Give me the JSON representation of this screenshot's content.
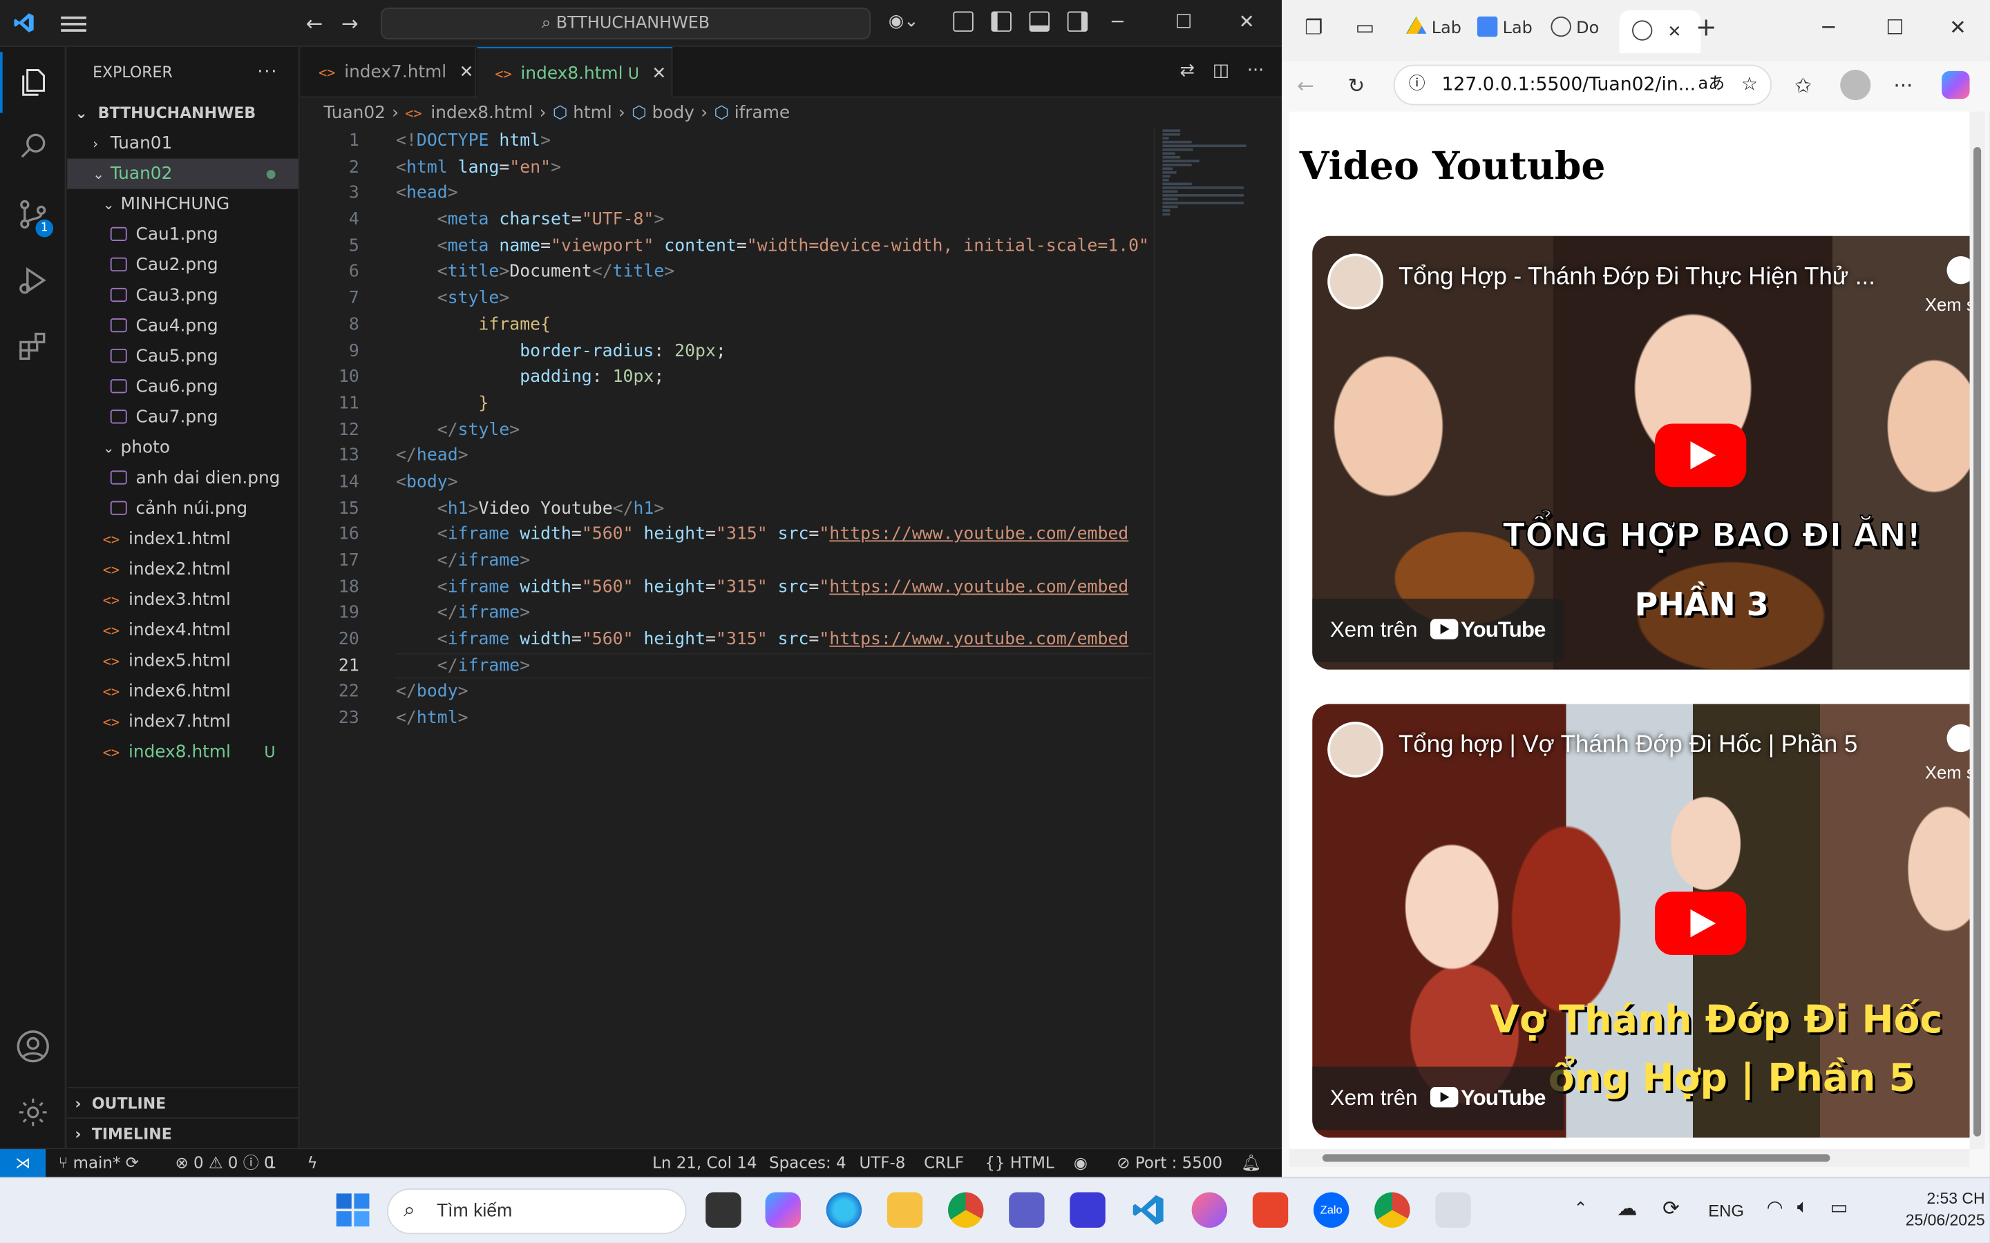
{
  "vscode": {
    "search_label": "BTTHUCHANHWEB",
    "explorer_title": "EXPLORER",
    "workspace_root": "BTTHUCHANHWEB",
    "tree": [
      {
        "label": "Tuan01",
        "type": "folder",
        "depth": 1,
        "open": false
      },
      {
        "label": "Tuan02",
        "type": "folder",
        "depth": 1,
        "open": true,
        "selected": true
      },
      {
        "label": "MINHCHUNG",
        "type": "folder",
        "depth": 2,
        "open": true
      },
      {
        "label": "Cau1.png",
        "type": "image",
        "depth": 3
      },
      {
        "label": "Cau2.png",
        "type": "image",
        "depth": 3
      },
      {
        "label": "Cau3.png",
        "type": "image",
        "depth": 3
      },
      {
        "label": "Cau4.png",
        "type": "image",
        "depth": 3
      },
      {
        "label": "Cau5.png",
        "type": "image",
        "depth": 3
      },
      {
        "label": "Cau6.png",
        "type": "image",
        "depth": 3
      },
      {
        "label": "Cau7.png",
        "type": "image",
        "depth": 3
      },
      {
        "label": "photo",
        "type": "folder",
        "depth": 2,
        "open": true
      },
      {
        "label": "anh dai dien.png",
        "type": "image",
        "depth": 3
      },
      {
        "label": "cảnh núi.png",
        "type": "image",
        "depth": 3
      },
      {
        "label": "index1.html",
        "type": "html",
        "depth": 2
      },
      {
        "label": "index2.html",
        "type": "html",
        "depth": 2
      },
      {
        "label": "index3.html",
        "type": "html",
        "depth": 2
      },
      {
        "label": "index4.html",
        "type": "html",
        "depth": 2
      },
      {
        "label": "index5.html",
        "type": "html",
        "depth": 2
      },
      {
        "label": "index6.html",
        "type": "html",
        "depth": 2
      },
      {
        "label": "index7.html",
        "type": "html",
        "depth": 2
      },
      {
        "label": "index8.html",
        "type": "html",
        "depth": 2,
        "git": "U",
        "modified": true
      }
    ],
    "outline_label": "OUTLINE",
    "timeline_label": "TIMELINE",
    "tabs": [
      {
        "label": "index7.html",
        "active": false
      },
      {
        "label": "index8.html",
        "active": true,
        "git": "U"
      }
    ],
    "breadcrumb": [
      "Tuan02",
      "index8.html",
      "html",
      "body",
      "iframe"
    ],
    "current_line": 21,
    "code": [
      [
        [
          "br",
          "<!"
        ],
        [
          "tag",
          "DOCTYPE"
        ],
        [
          "txt",
          " "
        ],
        [
          "attr",
          "html"
        ],
        [
          "br",
          ">"
        ]
      ],
      [
        [
          "br",
          "<"
        ],
        [
          "tag",
          "html"
        ],
        [
          "txt",
          " "
        ],
        [
          "attr",
          "lang"
        ],
        [
          "txt",
          "="
        ],
        [
          "str",
          "\"en\""
        ],
        [
          "br",
          ">"
        ]
      ],
      [
        [
          "br",
          "<"
        ],
        [
          "tag",
          "head"
        ],
        [
          "br",
          ">"
        ]
      ],
      [
        [
          "txt",
          "    "
        ],
        [
          "br",
          "<"
        ],
        [
          "tag",
          "meta"
        ],
        [
          "txt",
          " "
        ],
        [
          "attr",
          "charset"
        ],
        [
          "txt",
          "="
        ],
        [
          "str",
          "\"UTF-8\""
        ],
        [
          "br",
          ">"
        ]
      ],
      [
        [
          "txt",
          "    "
        ],
        [
          "br",
          "<"
        ],
        [
          "tag",
          "meta"
        ],
        [
          "txt",
          " "
        ],
        [
          "attr",
          "name"
        ],
        [
          "txt",
          "="
        ],
        [
          "str",
          "\"viewport\""
        ],
        [
          "txt",
          " "
        ],
        [
          "attr",
          "content"
        ],
        [
          "txt",
          "="
        ],
        [
          "str",
          "\"width=device-width, initial-scale=1.0\""
        ]
      ],
      [
        [
          "txt",
          "    "
        ],
        [
          "br",
          "<"
        ],
        [
          "tag",
          "title"
        ],
        [
          "br",
          ">"
        ],
        [
          "txt",
          "Document"
        ],
        [
          "br",
          "</"
        ],
        [
          "tag",
          "title"
        ],
        [
          "br",
          ">"
        ]
      ],
      [
        [
          "txt",
          "    "
        ],
        [
          "br",
          "<"
        ],
        [
          "tag",
          "style"
        ],
        [
          "br",
          ">"
        ]
      ],
      [
        [
          "txt",
          "        "
        ],
        [
          "sel",
          "iframe{"
        ]
      ],
      [
        [
          "txt",
          "            "
        ],
        [
          "prop",
          "border-radius"
        ],
        [
          "txt",
          ": "
        ],
        [
          "num",
          "20px"
        ],
        [
          "txt",
          ";"
        ]
      ],
      [
        [
          "txt",
          "            "
        ],
        [
          "prop",
          "padding"
        ],
        [
          "txt",
          ": "
        ],
        [
          "num",
          "10px"
        ],
        [
          "txt",
          ";"
        ]
      ],
      [
        [
          "txt",
          "        "
        ],
        [
          "sel",
          "}"
        ]
      ],
      [
        [
          "txt",
          "    "
        ],
        [
          "br",
          "</"
        ],
        [
          "tag",
          "style"
        ],
        [
          "br",
          ">"
        ]
      ],
      [
        [
          "br",
          "</"
        ],
        [
          "tag",
          "head"
        ],
        [
          "br",
          ">"
        ]
      ],
      [
        [
          "br",
          "<"
        ],
        [
          "tag",
          "body"
        ],
        [
          "br",
          ">"
        ]
      ],
      [
        [
          "txt",
          "    "
        ],
        [
          "br",
          "<"
        ],
        [
          "tag",
          "h1"
        ],
        [
          "br",
          ">"
        ],
        [
          "txt",
          "Video Youtube"
        ],
        [
          "br",
          "</"
        ],
        [
          "tag",
          "h1"
        ],
        [
          "br",
          ">"
        ]
      ],
      [
        [
          "txt",
          "    "
        ],
        [
          "br",
          "<"
        ],
        [
          "tag",
          "iframe"
        ],
        [
          "txt",
          " "
        ],
        [
          "attr",
          "width"
        ],
        [
          "txt",
          "="
        ],
        [
          "str",
          "\"560\""
        ],
        [
          "txt",
          " "
        ],
        [
          "attr",
          "height"
        ],
        [
          "txt",
          "="
        ],
        [
          "str",
          "\"315\""
        ],
        [
          "txt",
          " "
        ],
        [
          "attr",
          "src"
        ],
        [
          "txt",
          "="
        ],
        [
          "str",
          "\""
        ],
        [
          "url",
          "https://www.youtube.com/embed"
        ]
      ],
      [
        [
          "txt",
          "    "
        ],
        [
          "br",
          "</"
        ],
        [
          "tag",
          "iframe"
        ],
        [
          "br",
          ">"
        ]
      ],
      [
        [
          "txt",
          "    "
        ],
        [
          "br",
          "<"
        ],
        [
          "tag",
          "iframe"
        ],
        [
          "txt",
          " "
        ],
        [
          "attr",
          "width"
        ],
        [
          "txt",
          "="
        ],
        [
          "str",
          "\"560\""
        ],
        [
          "txt",
          " "
        ],
        [
          "attr",
          "height"
        ],
        [
          "txt",
          "="
        ],
        [
          "str",
          "\"315\""
        ],
        [
          "txt",
          " "
        ],
        [
          "attr",
          "src"
        ],
        [
          "txt",
          "="
        ],
        [
          "str",
          "\""
        ],
        [
          "url",
          "https://www.youtube.com/embed"
        ]
      ],
      [
        [
          "txt",
          "    "
        ],
        [
          "br",
          "</"
        ],
        [
          "tag",
          "iframe"
        ],
        [
          "br",
          ">"
        ]
      ],
      [
        [
          "txt",
          "    "
        ],
        [
          "br",
          "<"
        ],
        [
          "tag",
          "iframe"
        ],
        [
          "txt",
          " "
        ],
        [
          "attr",
          "width"
        ],
        [
          "txt",
          "="
        ],
        [
          "str",
          "\"560\""
        ],
        [
          "txt",
          " "
        ],
        [
          "attr",
          "height"
        ],
        [
          "txt",
          "="
        ],
        [
          "str",
          "\"315\""
        ],
        [
          "txt",
          " "
        ],
        [
          "attr",
          "src"
        ],
        [
          "txt",
          "="
        ],
        [
          "str",
          "\""
        ],
        [
          "url",
          "https://www.youtube.com/embed"
        ]
      ],
      [
        [
          "txt",
          "    "
        ],
        [
          "br",
          "</"
        ],
        [
          "tag",
          "iframe"
        ],
        [
          "br",
          ">"
        ]
      ],
      [
        [
          "br",
          "</"
        ],
        [
          "tag",
          "body"
        ],
        [
          "br",
          ">"
        ]
      ],
      [
        [
          "br",
          "</"
        ],
        [
          "tag",
          "html"
        ],
        [
          "br",
          ">"
        ]
      ]
    ],
    "status": {
      "branch": "main*",
      "errors": "0",
      "warnings": "0",
      "infos": "0",
      "ports": "1",
      "position": "Ln 21, Col 14",
      "spaces": "Spaces: 4",
      "encoding": "UTF-8",
      "eol": "CRLF",
      "language": "HTML",
      "port": "Port : 5500"
    },
    "colors": {
      "accent": "#0078d4",
      "git_untracked": "#73c991"
    }
  },
  "browser": {
    "tabs": [
      {
        "label": "Lab",
        "icon": "google-drive-icon"
      },
      {
        "label": "Lab",
        "icon": "google-docs-icon"
      },
      {
        "label": "Do",
        "icon": "globe-icon"
      },
      {
        "label": "",
        "icon": "globe-icon",
        "active": true
      }
    ],
    "url": "127.0.0.1:5500/Tuan02/in...",
    "page_heading": "Video Youtube",
    "videos": [
      {
        "title": "Tổng Hợp - Thánh Đớp Đi Thực Hiện Thử ...",
        "watch_later": "Xem sau",
        "watch_on": "Xem trên",
        "brand": "YouTube",
        "caption_1": "TỔNG HỢP BAO ĐI ĂN!",
        "caption_2": "PHẦN 3"
      },
      {
        "title": "Tổng hợp | Vợ Thánh Đớp Đi Hốc | Phần 5",
        "watch_later": "Xem sau",
        "watch_on": "Xem trên",
        "brand": "YouTube",
        "caption_1": "Vợ Thánh Đớp Đi Hốc",
        "caption_2": "ổng Hợp | Phần 5"
      }
    ]
  },
  "taskbar": {
    "search_placeholder": "Tìm kiếm",
    "language": "ENG",
    "time": "2:53 CH",
    "date": "25/06/2025",
    "zalo_label": "Zalo"
  }
}
